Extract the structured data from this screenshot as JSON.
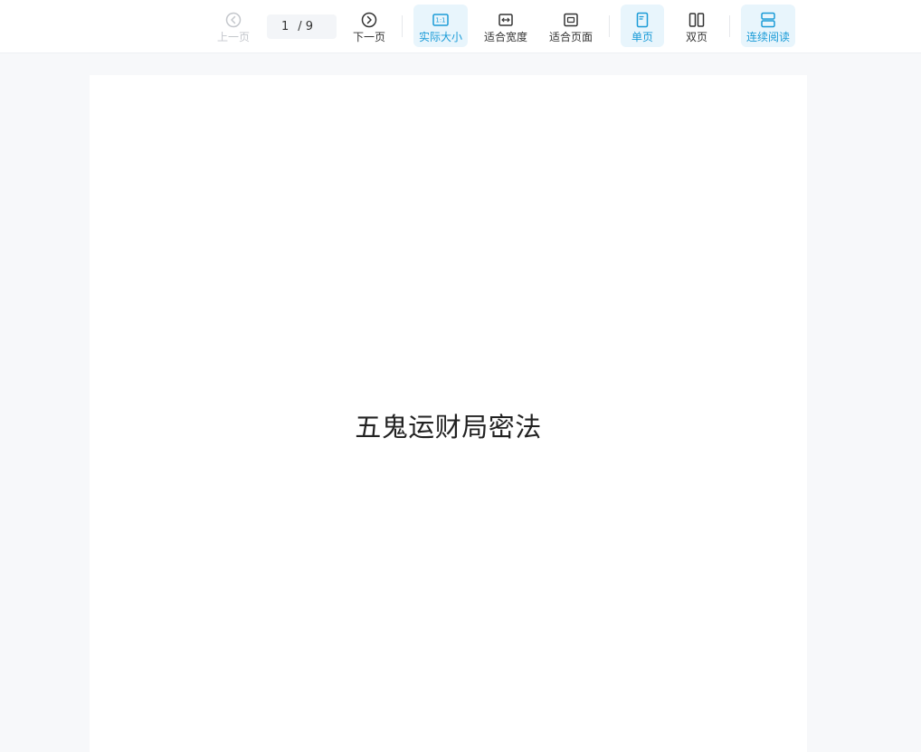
{
  "toolbar": {
    "prev_label": "上一页",
    "next_label": "下一页",
    "page_current": "1",
    "page_separator": "/",
    "page_total": "9",
    "actual_size_label": "实际大小",
    "fit_width_label": "适合宽度",
    "fit_page_label": "适合页面",
    "single_page_label": "单页",
    "double_page_label": "双页",
    "continuous_label": "连续阅读",
    "actual_size_icon_text": "1:1",
    "accent_color": "#1a9bd7"
  },
  "document": {
    "title": "五鬼运财局密法"
  }
}
